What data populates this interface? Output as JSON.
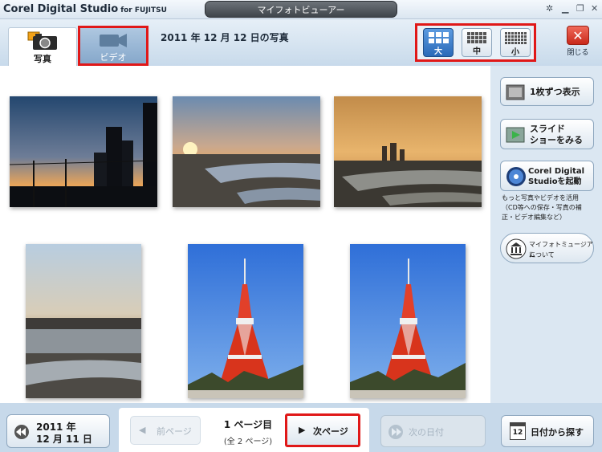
{
  "titlebar": {
    "app_name": "Corel Digital Studio",
    "app_suffix": "for FUJITSU",
    "window_title": "マイフォトビューアー"
  },
  "header": {
    "tabs": [
      {
        "label": "写真",
        "active": true
      },
      {
        "label": "ビデオ",
        "active": false
      }
    ],
    "heading": "2011 年 12 月 12 日の写真",
    "size_buttons": [
      {
        "label": "大",
        "active": true
      },
      {
        "label": "中",
        "active": false
      },
      {
        "label": "小",
        "active": false
      }
    ],
    "close_label": "閉じる"
  },
  "thumbnails": [
    {
      "subject": "sunset-railway-silhouette"
    },
    {
      "subject": "sunset-over-river"
    },
    {
      "subject": "city-skyline-dusk-river"
    },
    {
      "subject": "river-at-dusk-portrait"
    },
    {
      "subject": "tokyo-tower-blue-sky"
    },
    {
      "subject": "tokyo-tower-blue-sky"
    }
  ],
  "right_panel": {
    "single_view_label": "1枚ずつ表示",
    "slideshow_label_1": "スライド",
    "slideshow_label_2": "ショーをみる",
    "corel_label_1": "Corel Digital",
    "corel_label_2": "Studioを起動",
    "corel_caption_1": "もっと写真やビデオを活用",
    "corel_caption_2": "（CD等への保存・写真の補",
    "corel_caption_3": "正・ビデオ編集など）",
    "museum_label_1": "マイフォトミュージアム",
    "museum_label_2": "について"
  },
  "bottom": {
    "prev_date_1": "2011 年",
    "prev_date_2": "12 月 11 日",
    "prev_page": "前ページ",
    "page_current": "1 ページ目",
    "page_total": "(全 2 ページ)",
    "next_page": "次ページ",
    "next_date": "次の日付",
    "find_date": "日付から探す",
    "calendar_day": "12"
  },
  "colors": {
    "highlight": "#e01818",
    "active_blue": "#2a6ab8",
    "panel_bg": "#dbe7f2"
  }
}
